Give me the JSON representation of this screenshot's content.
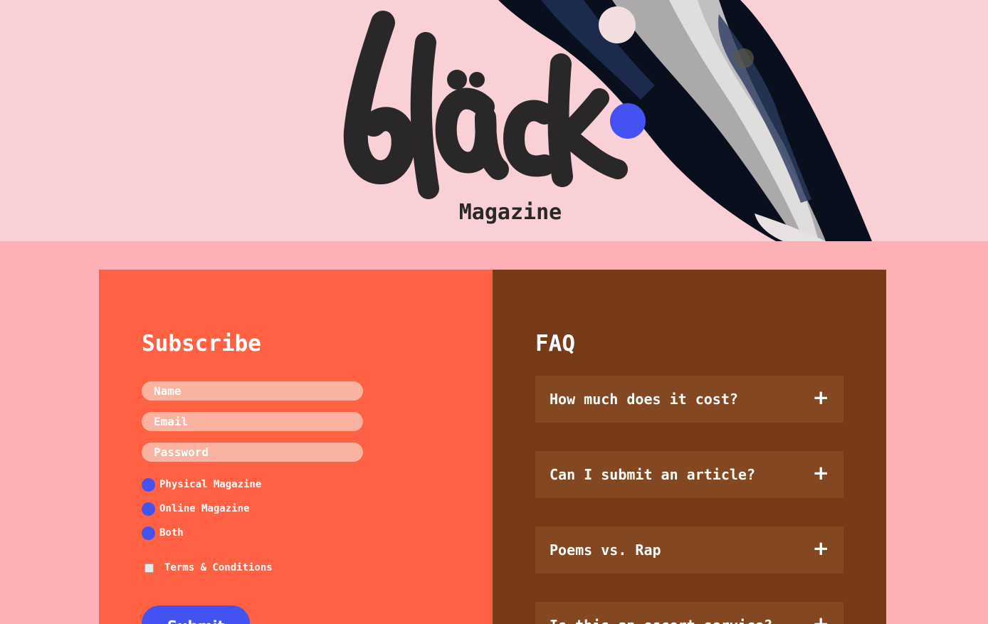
{
  "hero": {
    "logo_text": "bläck",
    "subtitle": "Magazine"
  },
  "subscribe": {
    "title": "Subscribe",
    "fields": [
      {
        "placeholder": "Name"
      },
      {
        "placeholder": "Email"
      },
      {
        "placeholder": "Password"
      }
    ],
    "options": [
      {
        "label": "Physical Magazine"
      },
      {
        "label": "Online Magazine"
      },
      {
        "label": "Both"
      }
    ],
    "terms_label": "Terms & Conditions",
    "submit_label": "Submit"
  },
  "faq": {
    "title": "FAQ",
    "items": [
      {
        "question": "How much does it cost?",
        "icon": "plus-icon"
      },
      {
        "question": "Can I submit an article?",
        "icon": "plus-icon"
      },
      {
        "question": "Poems vs. Rap",
        "icon": "plus-icon"
      },
      {
        "question": "Is this an escort service?",
        "icon": "plus-icon"
      }
    ]
  },
  "colors": {
    "hero_bg": "#f8d0d6",
    "page_bg": "#ffafb6",
    "subscribe_bg": "#ff6142",
    "faq_bg": "#773b17",
    "faq_item_bg": "#834721",
    "accent_blue": "#4452f1",
    "logo_ink": "#2a2728"
  }
}
